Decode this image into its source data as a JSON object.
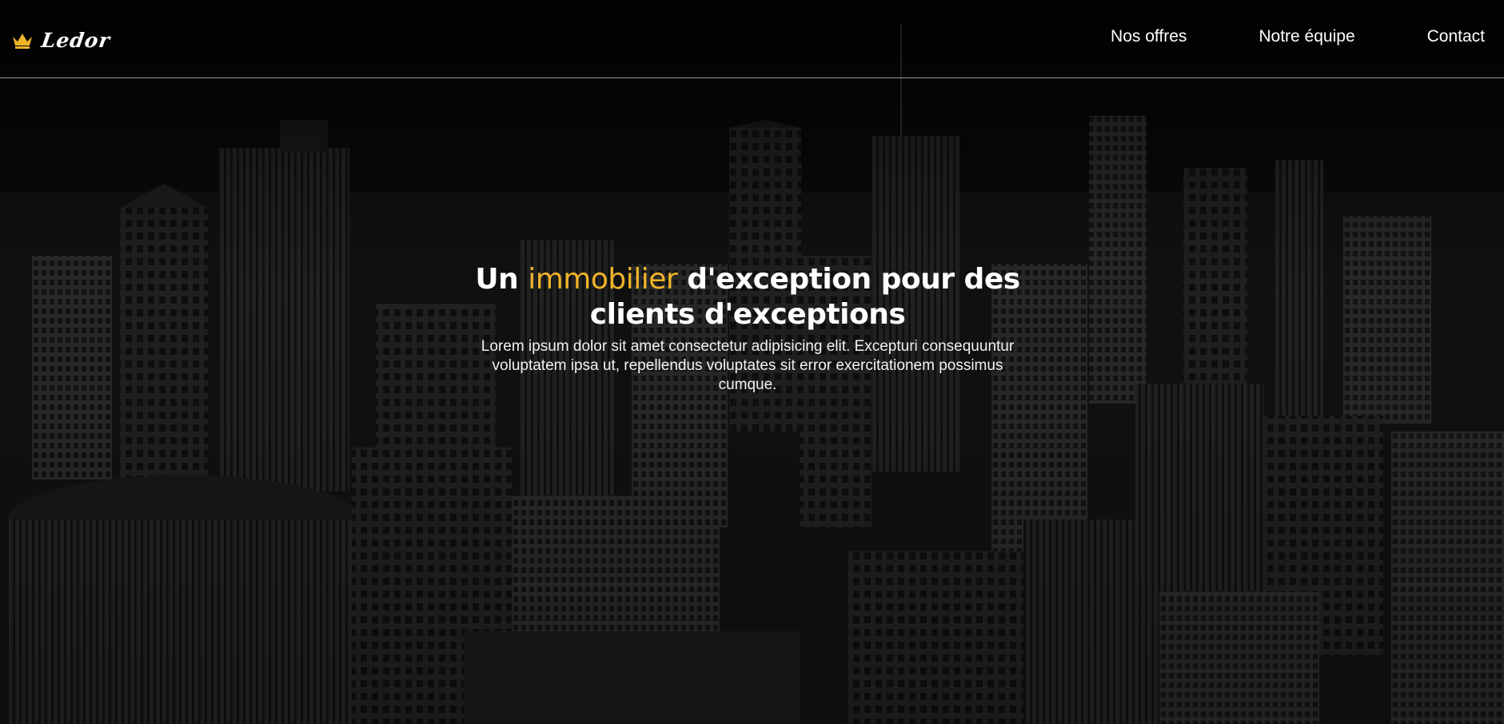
{
  "header": {
    "logo_text": "Ledor",
    "nav": [
      {
        "label": "Nos offres"
      },
      {
        "label": "Notre équipe"
      },
      {
        "label": "Contact"
      }
    ]
  },
  "hero": {
    "title_part1": "Un ",
    "title_accent": "immobilier",
    "title_part2": " d'exception pour des clients d'exceptions",
    "description": "Lorem ipsum dolor sit amet consectetur adipisicing elit. Excepturi consequuntur voluptatem ipsa ut, repellendus voluptates sit error exercitationem possimus cumque."
  },
  "colors": {
    "accent": "#f0b429",
    "background": "#0b0b0b",
    "text": "#ffffff"
  },
  "icons": {
    "logo": "crown-icon"
  }
}
